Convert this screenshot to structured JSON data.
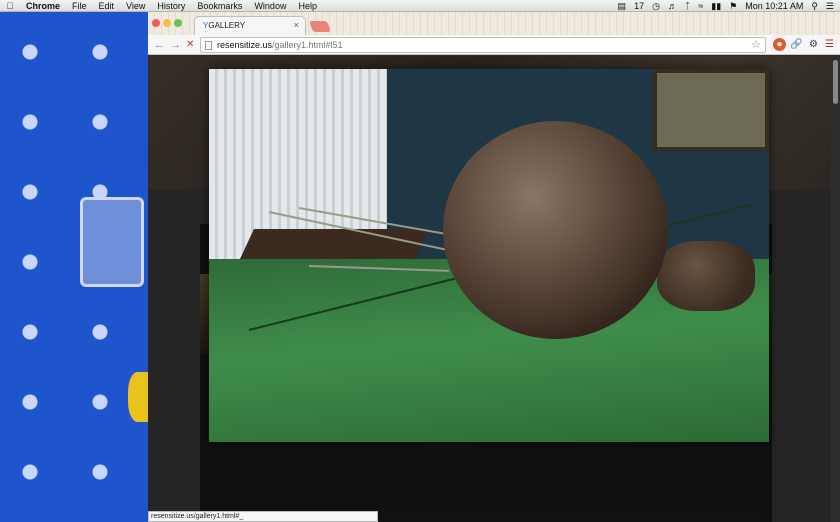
{
  "menubar": {
    "apple_icon": "",
    "app_name": "Chrome",
    "items": [
      "File",
      "Edit",
      "View",
      "History",
      "Bookmarks",
      "Window",
      "Help"
    ],
    "status": {
      "adobe_count": "17",
      "clock": "Mon 10:21 AM"
    }
  },
  "browser": {
    "tab": {
      "title": "GALLERY",
      "favicon_glyph": "Y",
      "close_glyph": "×"
    },
    "toolbar": {
      "back_glyph": "←",
      "forward_glyph": "→",
      "stop_glyph": "✕",
      "url_host": "resensitize.us",
      "url_path": "/gallery1.html#l51",
      "star_glyph": "☆"
    },
    "status_url": "resensitize.us/gallery1.html#_"
  },
  "icons": {
    "extensions": [
      "adblock-icon",
      "link-icon",
      "gear-icon",
      "menu-icon"
    ]
  },
  "colors": {
    "close": "#ec5f56",
    "minimize": "#f5bd4f",
    "maximize": "#62c654"
  }
}
